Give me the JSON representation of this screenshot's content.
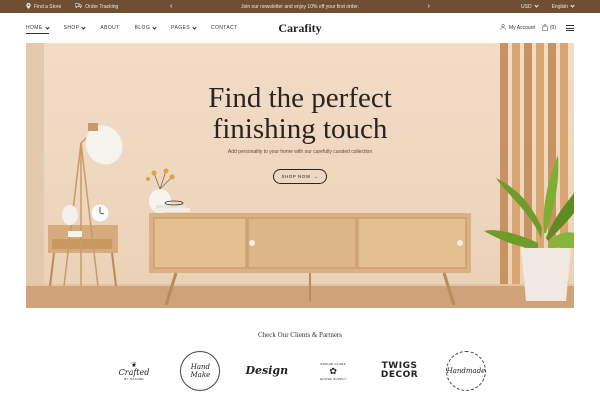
{
  "topbar": {
    "store_label": "Find a Store",
    "tracking_label": "Order Tracking",
    "announcement": "Join our newsletter and enjoy 10% off your first order.",
    "currency": "USD",
    "language": "English",
    "bg_color": "#6e4f33"
  },
  "header": {
    "nav": [
      "HOME",
      "SHOP",
      "ABOUT",
      "BLOG",
      "PAGES",
      "CONTACT"
    ],
    "logo": "Carafity",
    "account_label": "My Account",
    "cart_count": "(0)"
  },
  "hero": {
    "title_line1": "Find the perfect",
    "title_line2": "finishing touch",
    "subtitle": "Add personality to your home with our carefully curated collection",
    "button_label": "SHOP NOW"
  },
  "partners": {
    "title": "Check Our Clients & Partners",
    "logos": [
      {
        "main": "Crafted",
        "sub": "BY NATURE"
      },
      {
        "main": "Hand Make",
        "sub": ""
      },
      {
        "main": "Design",
        "sub": ""
      },
      {
        "main": "SOPHIE CLARK",
        "sub": "HOUSE SUPPLY"
      },
      {
        "main": "TWIGS",
        "sub": "DECOR"
      },
      {
        "main": "Handmade",
        "sub": ""
      }
    ]
  },
  "icons": [
    "pin-icon",
    "truck-icon",
    "chevron-left-icon",
    "chevron-right-icon",
    "user-icon",
    "bag-icon",
    "menu-icon"
  ]
}
